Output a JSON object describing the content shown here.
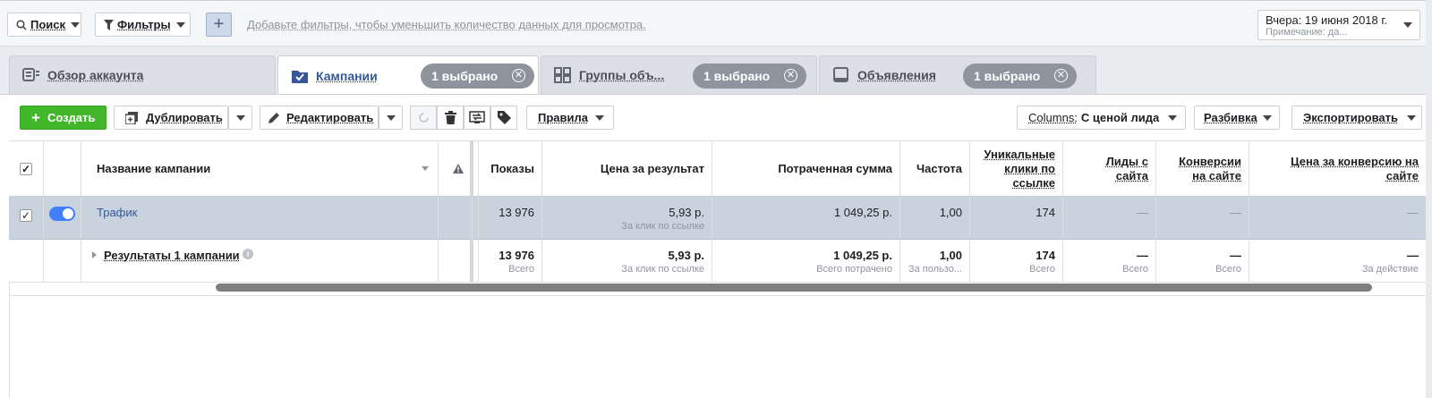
{
  "topbar": {
    "search_label": "Поиск",
    "filters_label": "Фильтры",
    "add_label": "+",
    "hint": "Добавьте фильтры, чтобы уменьшить количество данных для просмотра.",
    "date_label": "Вчера: 19 июня 2018 г.",
    "note_label": "Примечание: да..."
  },
  "tabs": [
    {
      "label": "Обзор аккаунта",
      "icon": "account-overview-icon"
    },
    {
      "label": "Кампании",
      "icon": "campaign-folder-icon",
      "pill": "1 выбрано"
    },
    {
      "label": "Группы объ...",
      "icon": "ad-sets-icon",
      "pill": "1 выбрано"
    },
    {
      "label": "Объявления",
      "icon": "ads-icon",
      "pill": "1 выбрано"
    }
  ],
  "toolbar": {
    "create_label": "Создать",
    "duplicate_label": "Дублировать",
    "edit_label": "Редактировать",
    "rules_label": "Правила",
    "columns_prefix": "Columns:",
    "columns_value": "С ценой лида",
    "breakdown_label": "Разбивка",
    "export_label": "Экспортировать"
  },
  "table": {
    "headers": {
      "name": "Название кампании",
      "impressions": "Показы",
      "cost_per_result": "Цена за результат",
      "amount_spent": "Потраченная сумма",
      "frequency": "Частота",
      "unique_clicks_1": "Уникальные",
      "unique_clicks_2": "клики по",
      "unique_clicks_3": "ссылке",
      "leads_1": "Лиды с",
      "leads_2": "сайта",
      "conv_1": "Конверсии",
      "conv_2": "на сайте",
      "cpc_1": "Цена за конверсию на",
      "cpc_2": "сайте"
    },
    "row": {
      "name": "Трафик",
      "impressions": "13 976",
      "cost_per_result": "5,93 р.",
      "cost_per_result_sub": "За клик по ссылке",
      "amount_spent": "1 049,25 р.",
      "frequency": "1,00",
      "unique_clicks": "174",
      "leads": "—",
      "conversions": "—",
      "cost_per_conversion": "—"
    },
    "summary": {
      "name": "Результаты 1 кампании",
      "impressions": "13 976",
      "impressions_sub": "Всего",
      "cost_per_result": "5,93 р.",
      "cost_per_result_sub": "За клик по ссылке",
      "amount_spent": "1 049,25 р.",
      "amount_spent_sub": "Всего потрачено",
      "frequency": "1,00",
      "frequency_sub": "За пользо...",
      "unique_clicks": "174",
      "unique_clicks_sub": "Всего",
      "leads": "—",
      "leads_sub": "Всего",
      "conversions": "—",
      "conversions_sub": "Всего",
      "cost_per_conversion": "—",
      "cost_per_conversion_sub": "За действие"
    }
  },
  "colors": {
    "accent": "#4080ff",
    "create": "#42b72a",
    "selected_row": "#c9d3dd",
    "pill": "#8d949e"
  }
}
